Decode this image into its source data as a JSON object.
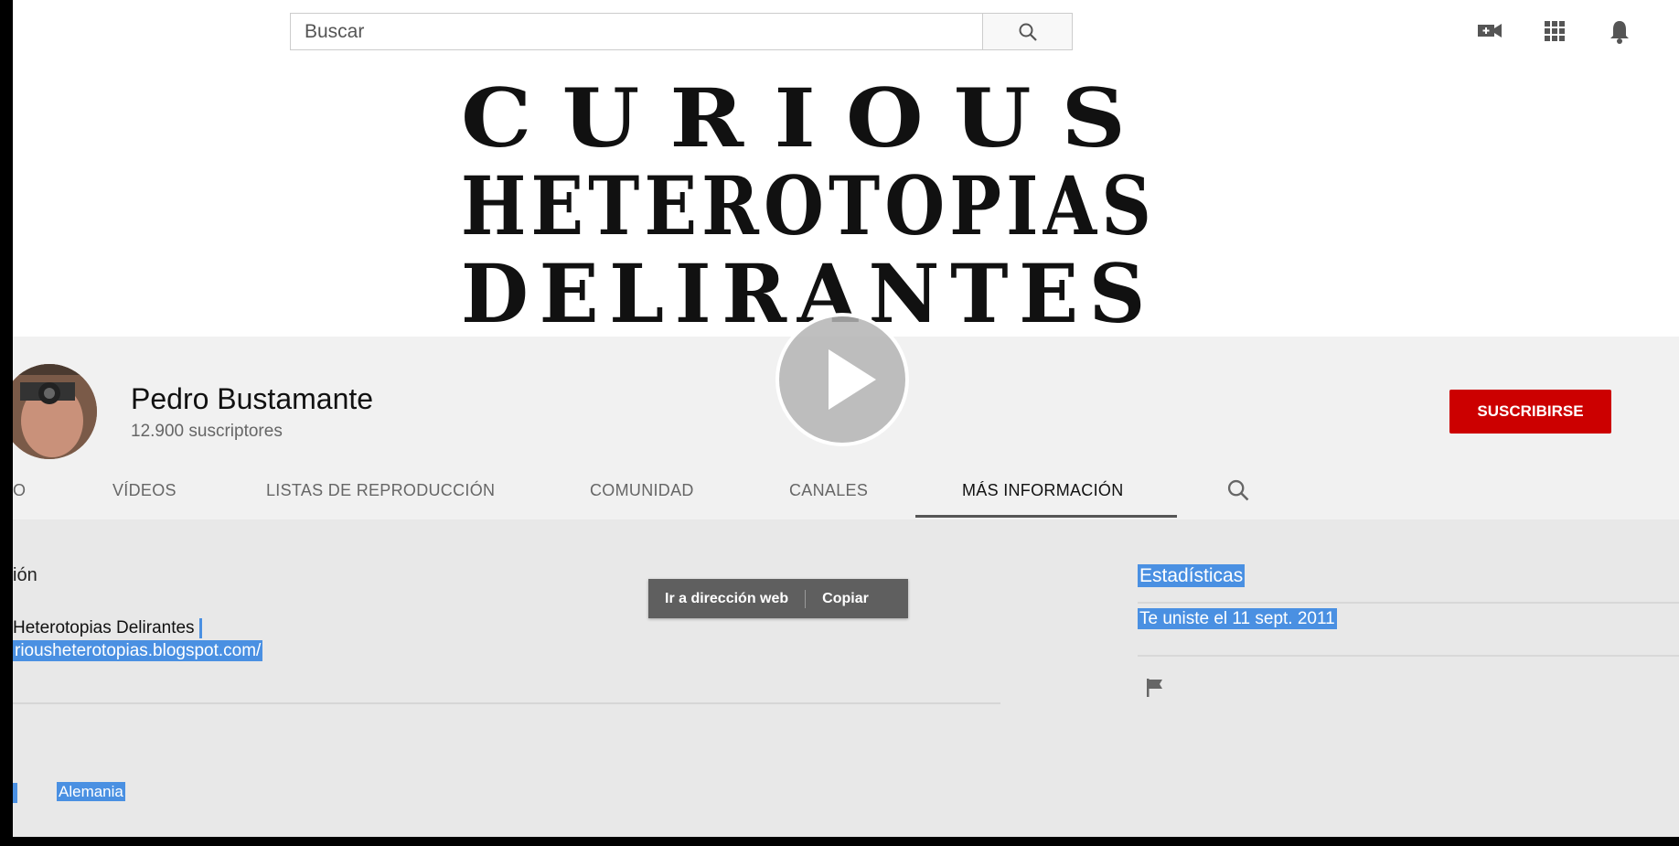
{
  "search": {
    "placeholder": "Buscar"
  },
  "top_icons": [
    "video-camera-add-icon",
    "apps-grid-icon",
    "notifications-bell-icon"
  ],
  "banner": {
    "lines": [
      "CURIOUS",
      "HETEROTOPIAS",
      "DELIRANTES"
    ]
  },
  "channel": {
    "name": "Pedro Bustamante",
    "subscribers": "12.900 suscriptores",
    "subscribe_label": "SUSCRIBIRSE"
  },
  "tabs": [
    {
      "label": "O"
    },
    {
      "label": "VÍDEOS"
    },
    {
      "label": "LISTAS DE REPRODUCCIÓN"
    },
    {
      "label": "COMUNIDAD"
    },
    {
      "label": "CANALES"
    },
    {
      "label": "MÁS INFORMACIÓN"
    }
  ],
  "about": {
    "description_title": "ión",
    "desc_line_1": "Heterotopias Delirantes",
    "desc_line_2": "riousheterotopias.blogspot.com/",
    "location": "Alemania"
  },
  "context_menu": {
    "go_label": "Ir a dirección web",
    "copy_label": "Copiar"
  },
  "stats": {
    "title": "Estadísticas",
    "joined": "Te uniste el 11 sept. 2011"
  },
  "colors": {
    "subscribe": "#cc0000",
    "selection": "#4a90e2"
  }
}
